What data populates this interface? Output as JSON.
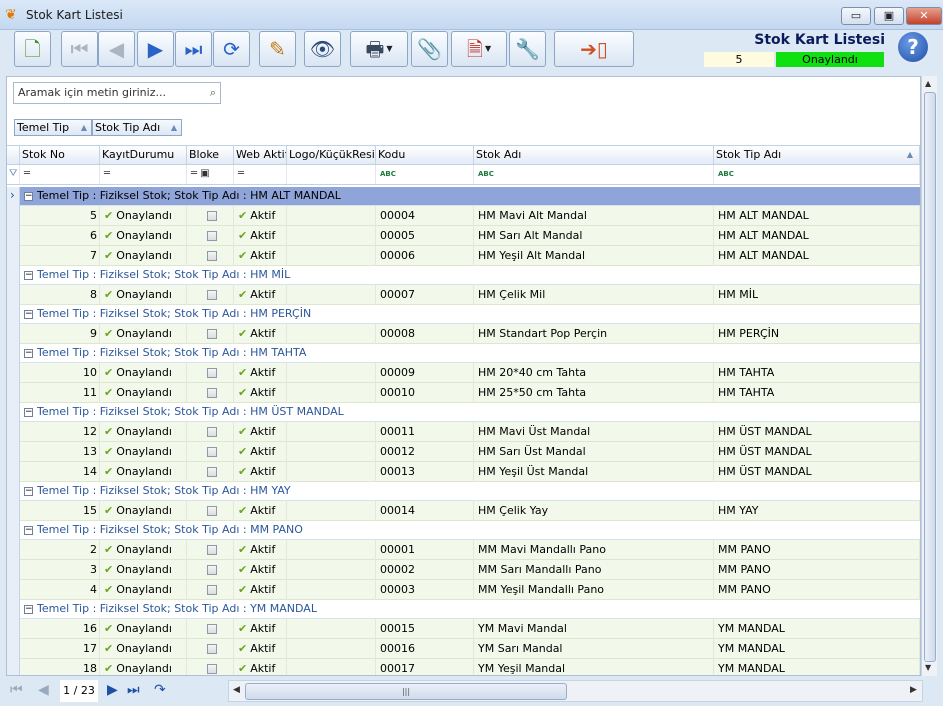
{
  "window": {
    "title": "Stok Kart Listesi",
    "minimize_label": "▭",
    "maximize_label": "▣",
    "close_label": "✕"
  },
  "header": {
    "title": "Stok Kart Listesi",
    "count": "5",
    "status": "Onaylandı",
    "help_label": "?"
  },
  "search": {
    "placeholder": "Aramak için metin giriniz..."
  },
  "group_boxes": [
    "Temel Tip",
    "Stok Tip Adı"
  ],
  "columns": [
    "Stok No",
    "KayıtDurumu",
    "Bloke",
    "Web Aktif",
    "Logo/KüçükResim",
    "Kodu",
    "Stok Adı",
    "Stok Tip Adı"
  ],
  "groups": [
    {
      "label": "Temel Tip : Fiziksel Stok;  Stok Tip Adı : HM ALT MANDAL",
      "selected": true,
      "rows": [
        {
          "no": "5",
          "durum": "Onaylandı",
          "web": "Aktif",
          "kodu": "00004",
          "adi": "HM Mavi Alt Mandal",
          "tip": "HM ALT MANDAL"
        },
        {
          "no": "6",
          "durum": "Onaylandı",
          "web": "Aktif",
          "kodu": "00005",
          "adi": "HM Sarı Alt Mandal",
          "tip": "HM ALT MANDAL"
        },
        {
          "no": "7",
          "durum": "Onaylandı",
          "web": "Aktif",
          "kodu": "00006",
          "adi": "HM Yeşil Alt Mandal",
          "tip": "HM ALT MANDAL"
        }
      ]
    },
    {
      "label": "Temel Tip : Fiziksel Stok;  Stok Tip Adı : HM MİL",
      "rows": [
        {
          "no": "8",
          "durum": "Onaylandı",
          "web": "Aktif",
          "kodu": "00007",
          "adi": "HM Çelik Mil",
          "tip": "HM MİL"
        }
      ]
    },
    {
      "label": "Temel Tip : Fiziksel Stok;  Stok Tip Adı : HM PERÇİN",
      "rows": [
        {
          "no": "9",
          "durum": "Onaylandı",
          "web": "Aktif",
          "kodu": "00008",
          "adi": "HM Standart Pop Perçin",
          "tip": "HM PERÇİN"
        }
      ]
    },
    {
      "label": "Temel Tip : Fiziksel Stok;  Stok Tip Adı : HM TAHTA",
      "rows": [
        {
          "no": "10",
          "durum": "Onaylandı",
          "web": "Aktif",
          "kodu": "00009",
          "adi": "HM 20*40 cm Tahta",
          "tip": "HM TAHTA"
        },
        {
          "no": "11",
          "durum": "Onaylandı",
          "web": "Aktif",
          "kodu": "00010",
          "adi": "HM 25*50 cm Tahta",
          "tip": "HM TAHTA"
        }
      ]
    },
    {
      "label": "Temel Tip : Fiziksel Stok;  Stok Tip Adı : HM ÜST MANDAL",
      "rows": [
        {
          "no": "12",
          "durum": "Onaylandı",
          "web": "Aktif",
          "kodu": "00011",
          "adi": "HM Mavi Üst Mandal",
          "tip": "HM ÜST MANDAL"
        },
        {
          "no": "13",
          "durum": "Onaylandı",
          "web": "Aktif",
          "kodu": "00012",
          "adi": "HM Sarı Üst Mandal",
          "tip": "HM ÜST MANDAL"
        },
        {
          "no": "14",
          "durum": "Onaylandı",
          "web": "Aktif",
          "kodu": "00013",
          "adi": "HM Yeşil Üst Mandal",
          "tip": "HM ÜST MANDAL"
        }
      ]
    },
    {
      "label": "Temel Tip : Fiziksel Stok;  Stok Tip Adı : HM YAY",
      "rows": [
        {
          "no": "15",
          "durum": "Onaylandı",
          "web": "Aktif",
          "kodu": "00014",
          "adi": "HM Çelik Yay",
          "tip": "HM YAY"
        }
      ]
    },
    {
      "label": "Temel Tip : Fiziksel Stok;  Stok Tip Adı : MM PANO",
      "rows": [
        {
          "no": "2",
          "durum": "Onaylandı",
          "web": "Aktif",
          "kodu": "00001",
          "adi": "MM Mavi Mandallı Pano",
          "tip": "MM PANO"
        },
        {
          "no": "3",
          "durum": "Onaylandı",
          "web": "Aktif",
          "kodu": "00002",
          "adi": "MM Sarı Mandallı Pano",
          "tip": "MM PANO"
        },
        {
          "no": "4",
          "durum": "Onaylandı",
          "web": "Aktif",
          "kodu": "00003",
          "adi": "MM Yeşil Mandallı Pano",
          "tip": "MM PANO"
        }
      ]
    },
    {
      "label": "Temel Tip : Fiziksel Stok;  Stok Tip Adı : YM MANDAL",
      "rows": [
        {
          "no": "16",
          "durum": "Onaylandı",
          "web": "Aktif",
          "kodu": "00015",
          "adi": "YM Mavi Mandal",
          "tip": "YM MANDAL"
        },
        {
          "no": "17",
          "durum": "Onaylandı",
          "web": "Aktif",
          "kodu": "00016",
          "adi": "YM Sarı Mandal",
          "tip": "YM MANDAL"
        },
        {
          "no": "18",
          "durum": "Onaylandı",
          "web": "Aktif",
          "kodu": "00017",
          "adi": "YM Yeşil Mandal",
          "tip": "YM MANDAL"
        }
      ]
    }
  ],
  "pager": {
    "info": "1 / 23"
  },
  "icons": {
    "app": "butterfly-icon",
    "new": "new-document-icon",
    "first": "first-record-icon",
    "prev": "previous-record-icon",
    "next": "next-record-icon",
    "last": "last-record-icon",
    "refresh": "refresh-icon",
    "edit": "edit-icon",
    "preview": "preview-icon",
    "print": "printer-icon",
    "attach": "attachment-icon",
    "pdf": "pdf-save-icon",
    "settings": "settings-icon",
    "exit": "exit-icon",
    "help": "help-icon",
    "search": "search-icon"
  },
  "colors": {
    "status_green": "#10e010",
    "group_text": "#2b579a",
    "selected_group": "#8fa4d8",
    "row_bg": "#f3f9ea"
  }
}
